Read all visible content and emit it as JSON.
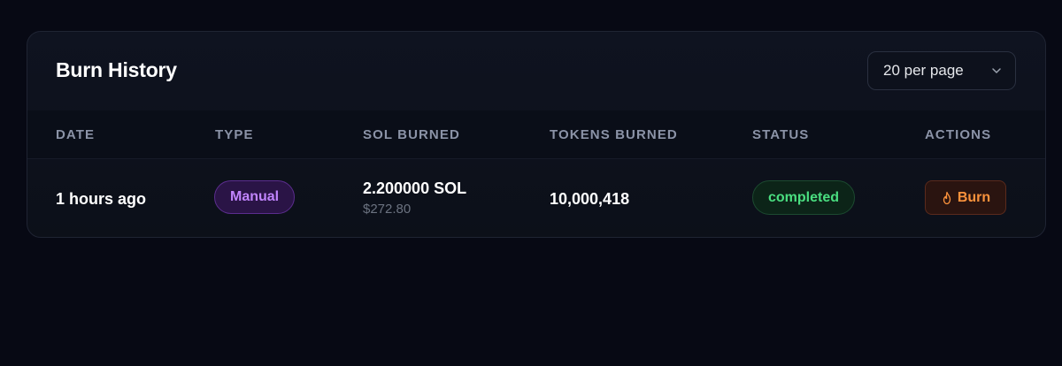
{
  "card": {
    "title": "Burn History",
    "per_page": "20 per page",
    "per_page_icon": "chevron-down-icon"
  },
  "table": {
    "headers": [
      "DATE",
      "TYPE",
      "SOL BURNED",
      "TOKENS BURNED",
      "STATUS",
      "ACTIONS"
    ],
    "rows": [
      {
        "date": "1 hours ago",
        "type": "Manual",
        "sol": "2.200000 SOL",
        "usd": "$272.80",
        "tokens": "10,000,418",
        "status": "completed",
        "action": "Burn",
        "action_icon": "flame-icon"
      }
    ]
  },
  "colors": {
    "background": "#070914",
    "type_badge": "#c084fc",
    "status_completed": "#4ade80",
    "burn_action": "#fb923c"
  }
}
